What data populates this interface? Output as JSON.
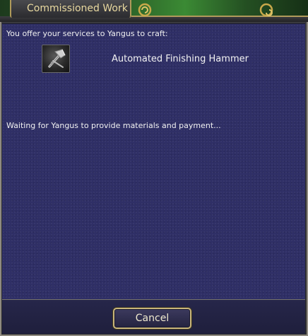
{
  "window": {
    "title": "Commissioned Work"
  },
  "dialog": {
    "offer_text": "You offer your services to Yangus to craft:",
    "item": {
      "name": "Automated Finishing Hammer",
      "icon": "hammer-icon"
    },
    "waiting_text": "Waiting for Yangus to provide materials and payment..."
  },
  "buttons": {
    "cancel_label": "Cancel"
  },
  "colors": {
    "content_bg": "#2f2f66",
    "frame": "#3a3a3e",
    "gold_trim": "#c8b57a",
    "title_text": "#e9d9a0"
  }
}
